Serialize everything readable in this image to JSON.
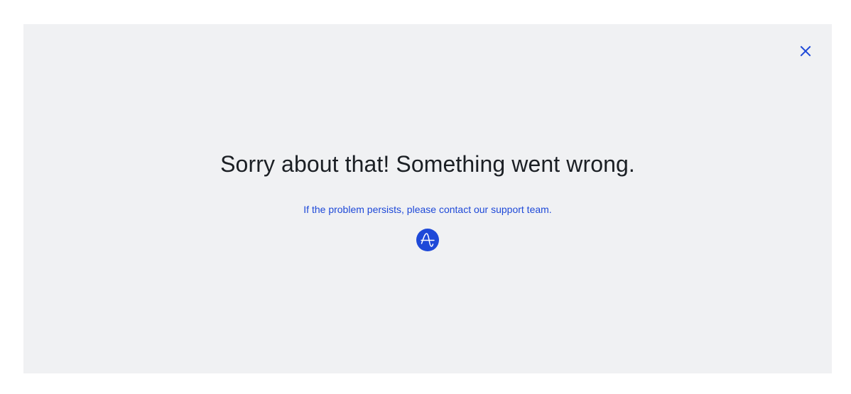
{
  "dialog": {
    "title": "Sorry about that! Something went wrong.",
    "message": "If the problem persists, please contact our support team.",
    "close_icon": "close-icon",
    "logo_icon": "amplitude-logo-icon"
  },
  "colors": {
    "panel_background": "#f0f1f3",
    "accent": "#1e49d8",
    "title_text": "#1b1f24"
  }
}
